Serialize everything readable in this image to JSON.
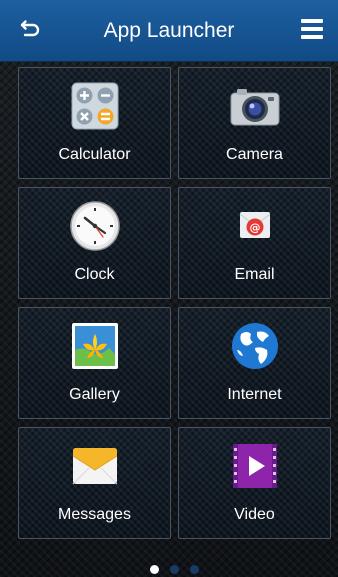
{
  "header": {
    "title": "App Launcher",
    "background_color": "#1d5fa0",
    "back_icon": "back-arrow-icon",
    "menu_icon": "hamburger-menu-icon"
  },
  "apps": [
    {
      "label": "Calculator",
      "icon": "calculator-icon"
    },
    {
      "label": "Camera",
      "icon": "camera-icon"
    },
    {
      "label": "Clock",
      "icon": "clock-icon"
    },
    {
      "label": "Email",
      "icon": "email-icon"
    },
    {
      "label": "Gallery",
      "icon": "gallery-icon"
    },
    {
      "label": "Internet",
      "icon": "globe-icon"
    },
    {
      "label": "Messages",
      "icon": "messages-icon"
    },
    {
      "label": "Video",
      "icon": "video-icon"
    }
  ],
  "pager": {
    "page_count": 3,
    "current_page": 1
  }
}
